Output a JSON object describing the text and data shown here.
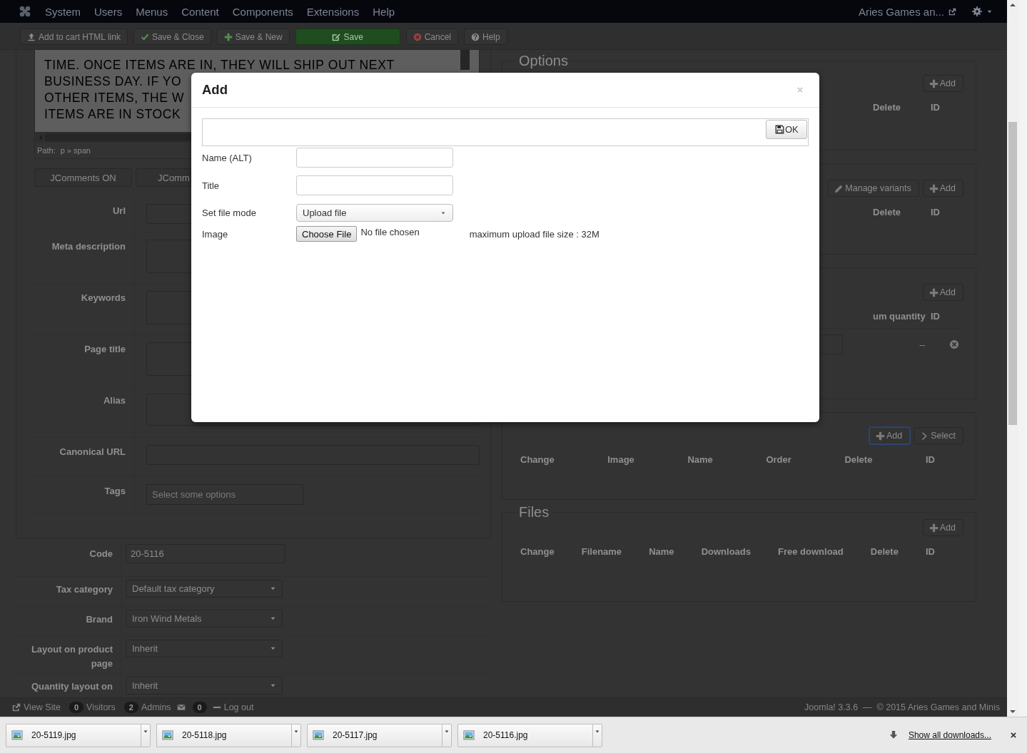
{
  "top_nav": {
    "menu": [
      "System",
      "Users",
      "Menus",
      "Content",
      "Components",
      "Extensions",
      "Help"
    ],
    "site_name": "Aries Games an..."
  },
  "toolbar": [
    {
      "label": "Add to cart HTML link",
      "kind": "upload"
    },
    {
      "label": "Save & Close",
      "kind": "check"
    },
    {
      "label": "Save & New",
      "kind": "plus"
    },
    {
      "label": "Save",
      "kind": "primary"
    },
    {
      "label": "Cancel",
      "kind": "cancel"
    },
    {
      "label": "Help",
      "kind": "help"
    }
  ],
  "editor": {
    "lines": [
      "TIME. ONCE ITEMS ARE IN, THEY WILL SHIP OUT NEXT",
      "BUSINESS DAY. IF YO",
      "OTHER ITEMS, THE W",
      "ITEMS ARE IN STOCK"
    ],
    "path_label": "Path:",
    "path": "p » span",
    "tabs": [
      "JComments ON",
      "JComm"
    ]
  },
  "seo_fields": [
    {
      "label": "Url",
      "kind": "input"
    },
    {
      "label": "Meta description",
      "kind": "textarea"
    },
    {
      "label": "Keywords",
      "kind": "textarea"
    },
    {
      "label": "Page title",
      "kind": "textarea"
    },
    {
      "label": "Alias",
      "kind": "textarea"
    },
    {
      "label": "Canonical URL",
      "kind": "input"
    },
    {
      "label": "Tags",
      "kind": "tags",
      "placeholder": "Select some options"
    }
  ],
  "product_fields": [
    {
      "label": "Code",
      "kind": "input",
      "value": "20-5116"
    },
    {
      "label": "Tax category",
      "kind": "select",
      "value": "Default tax category"
    },
    {
      "label": "Brand",
      "kind": "select",
      "value": "Iron Wind Metals"
    },
    {
      "label": "Layout on product page",
      "kind": "select",
      "value": "Inherit"
    },
    {
      "label": "Quantity layout on",
      "kind": "select",
      "value": "Inherit"
    }
  ],
  "right_panels": [
    {
      "legend": "Options",
      "buttons": [
        {
          "label": "Add",
          "kind": "plus",
          "focused": false
        }
      ],
      "columns": [
        "Delete",
        "ID"
      ]
    },
    {
      "buttons": [
        {
          "label": "Manage variants",
          "kind": "pencil",
          "focused": false
        },
        {
          "label": "Add",
          "kind": "plus",
          "focused": false
        }
      ],
      "columns": [
        "Delete",
        "ID"
      ]
    },
    {
      "buttons": [
        {
          "label": "Add",
          "kind": "plus",
          "focused": false
        }
      ],
      "columns": [
        "um quantity",
        "ID"
      ],
      "rows": [
        {
          "id": "--"
        }
      ]
    },
    {
      "buttons": [
        {
          "label": "Add",
          "kind": "plus",
          "focused": true
        },
        {
          "label": "Select",
          "kind": "chevron",
          "focused": false
        }
      ],
      "columns": [
        "Change",
        "Image",
        "Name",
        "Order",
        "Delete",
        "ID"
      ]
    },
    {
      "legend": "Files",
      "buttons": [
        {
          "label": "Add",
          "kind": "plus",
          "focused": false
        }
      ],
      "columns": [
        "Change",
        "Filename",
        "Name",
        "Downloads",
        "Free download",
        "Delete",
        "ID"
      ]
    }
  ],
  "status_bar": {
    "view_site": "View Site",
    "visitors_count": "0",
    "visitors": "Visitors",
    "admins_count": "2",
    "admins": "Admins",
    "messages_count": "0",
    "logout": "Log out",
    "footer": "Joomla! 3.3.6  —  © 2015 Aries Games and Minis"
  },
  "dialog": {
    "title": "Add",
    "ok": "OK",
    "fields": [
      {
        "label": "Name (ALT)",
        "kind": "input"
      },
      {
        "label": "Title",
        "kind": "input"
      },
      {
        "label": "Set file mode",
        "kind": "select",
        "value": "Upload file"
      },
      {
        "label": "Image",
        "kind": "file",
        "button": "Choose File",
        "status": "No file chosen",
        "note": "maximum upload file size : 32M"
      }
    ]
  },
  "downloads": {
    "files": [
      "20-5119.jpg",
      "20-5118.jpg",
      "20-5117.jpg",
      "20-5116.jpg"
    ],
    "show_all": "Show all downloads..."
  }
}
